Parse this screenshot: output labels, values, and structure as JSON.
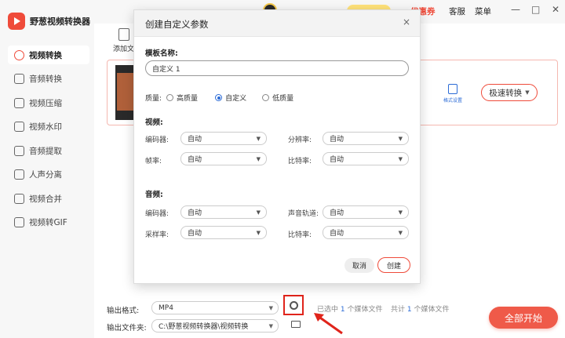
{
  "app": {
    "title": "野葱视频转换器"
  },
  "sidebar": {
    "items": [
      {
        "label": "视频转换",
        "active": true
      },
      {
        "label": "音频转换"
      },
      {
        "label": "视频压缩"
      },
      {
        "label": "视频水印"
      },
      {
        "label": "音频提取"
      },
      {
        "label": "人声分离"
      },
      {
        "label": "视频合并"
      },
      {
        "label": "视频转GIF"
      }
    ]
  },
  "topbar": {
    "coupon": "优惠券",
    "service": "客服",
    "menu": "菜单",
    "minimize": "—",
    "maximize": "□",
    "close": "✕"
  },
  "toolbar": {
    "add_file": "添加文"
  },
  "card": {
    "format_settings": "格式设置",
    "speed_convert": "极速转换"
  },
  "bottom": {
    "output_format_label": "输出格式:",
    "output_format_value": "MP4",
    "output_folder_label": "输出文件夹:",
    "output_folder_value": "C:\\野葱视频转换器\\视频转换",
    "selected_prefix": "已选中",
    "selected_count": "1",
    "selected_suffix": "个媒体文件",
    "total_prefix": "共计",
    "total_count": "1",
    "total_suffix": "个媒体文件",
    "start_all": "全部开始"
  },
  "dialog": {
    "title": "创建自定义参数",
    "close": "×",
    "template_name_label": "模板名称:",
    "template_name_value": "自定义 1",
    "quality_label": "质量:",
    "quality_options": [
      "高质量",
      "自定义",
      "低质量"
    ],
    "quality_selected": "自定义",
    "video_section": "视频:",
    "video": {
      "encoder_label": "编码器:",
      "encoder_value": "自动",
      "resolution_label": "分辨率:",
      "resolution_value": "自动",
      "framerate_label": "帧率:",
      "framerate_value": "自动",
      "bitrate_label": "比特率:",
      "bitrate_value": "自动"
    },
    "audio_section": "音频:",
    "audio": {
      "encoder_label": "编码器:",
      "encoder_value": "自动",
      "channel_label": "声音轨道:",
      "channel_value": "自动",
      "samplerate_label": "采样率:",
      "samplerate_value": "自动",
      "bitrate_label": "比特率:",
      "bitrate_value": "自动"
    },
    "cancel": "取消",
    "create": "创建"
  },
  "colors": {
    "accent": "#ef4b3a",
    "link": "#2b6bd6",
    "highlight": "#e0241b"
  }
}
